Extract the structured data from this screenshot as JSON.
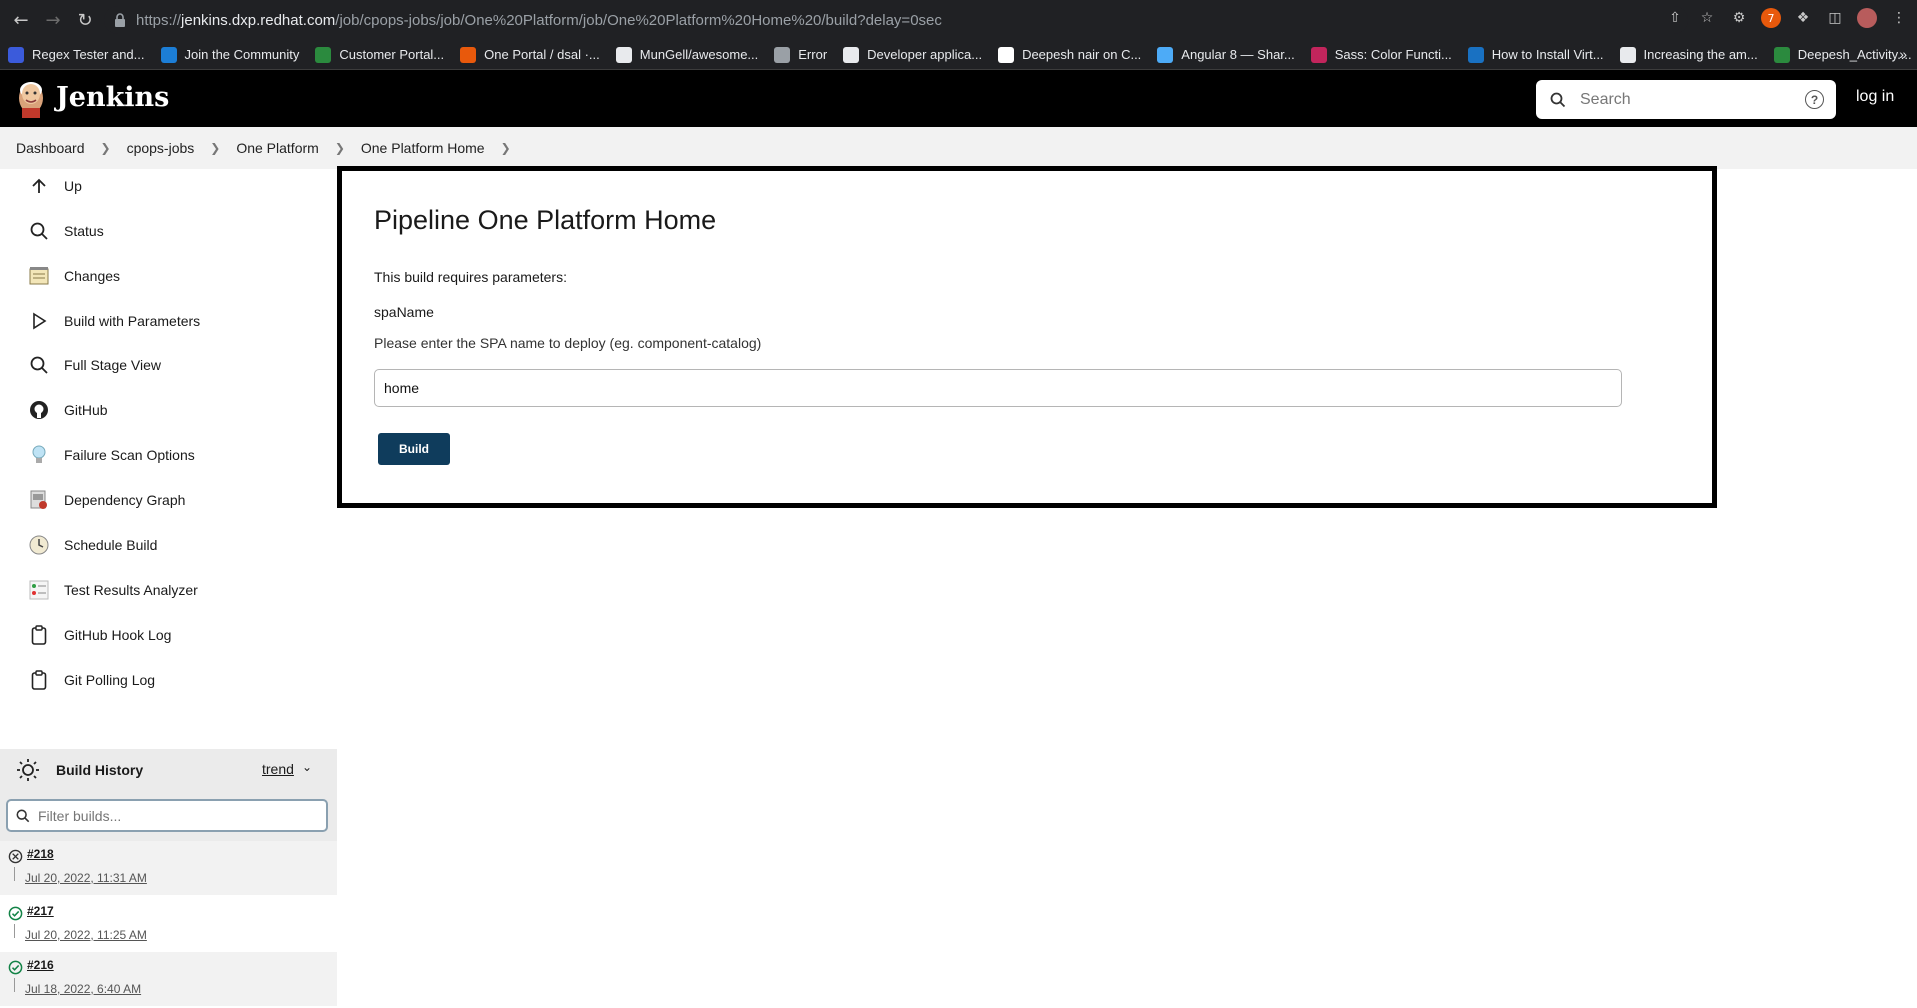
{
  "browser": {
    "url_prefix": "https://",
    "url_host": "jenkins.dxp.redhat.com",
    "url_path": "/job/cpops-jobs/job/One%20Platform/job/One%20Platform%20Home%20/build?delay=0sec",
    "bookmarks": [
      {
        "label": "Regex Tester and...",
        "color": "#3b5bdb"
      },
      {
        "label": "Join the Community",
        "color": "#1c7ed6"
      },
      {
        "label": "Customer Portal...",
        "color": "#2b8a3e"
      },
      {
        "label": "One Portal / dsal ·...",
        "color": "#e8590c"
      },
      {
        "label": "MunGell/awesome...",
        "color": "#e8eaed"
      },
      {
        "label": "Error",
        "color": "#9aa0a6"
      },
      {
        "label": "Developer applica...",
        "color": "#e8eaed"
      },
      {
        "label": "Deepesh nair on C...",
        "color": "#ffffff"
      },
      {
        "label": "Angular 8 — Shar...",
        "color": "#4dabf7"
      },
      {
        "label": "Sass: Color Functi...",
        "color": "#c2255c"
      },
      {
        "label": "How to Install Virt...",
        "color": "#1971c2"
      },
      {
        "label": "Increasing the am...",
        "color": "#e8eaed"
      },
      {
        "label": "Deepesh_Activity....",
        "color": "#2b8a3e"
      }
    ],
    "more": "»"
  },
  "header": {
    "title": "Jenkins",
    "search_placeholder": "Search",
    "help": "?",
    "login": "log in"
  },
  "breadcrumbs": [
    "Dashboard",
    "cpops-jobs",
    "One Platform",
    "One Platform Home"
  ],
  "sidebar": {
    "tasks": [
      {
        "label": "Up",
        "icon": "arrow-up-icon"
      },
      {
        "label": "Status",
        "icon": "search-icon"
      },
      {
        "label": "Changes",
        "icon": "notepad-icon"
      },
      {
        "label": "Build with Parameters",
        "icon": "play-icon"
      },
      {
        "label": "Full Stage View",
        "icon": "search-icon"
      },
      {
        "label": "GitHub",
        "icon": "github-icon"
      },
      {
        "label": "Failure Scan Options",
        "icon": "lightbulb-icon"
      },
      {
        "label": "Dependency Graph",
        "icon": "graph-icon"
      },
      {
        "label": "Schedule Build",
        "icon": "clock-icon"
      },
      {
        "label": "Test Results Analyzer",
        "icon": "analyzer-icon"
      },
      {
        "label": "GitHub Hook Log",
        "icon": "clipboard-icon"
      },
      {
        "label": "Git Polling Log",
        "icon": "clipboard-icon"
      }
    ]
  },
  "build_history": {
    "title": "Build History",
    "trend": "trend",
    "filter_placeholder": "Filter builds...",
    "builds": [
      {
        "number": "#218",
        "date": "Jul 20, 2022, 11:31 AM",
        "status": "aborted"
      },
      {
        "number": "#217",
        "date": "Jul 20, 2022, 11:25 AM",
        "status": "success"
      },
      {
        "number": "#216",
        "date": "Jul 18, 2022, 6:40 AM",
        "status": "success"
      }
    ]
  },
  "main": {
    "title": "Pipeline One Platform Home",
    "requires_text": "This build requires parameters:",
    "param_name": "spaName",
    "param_description": "Please enter the SPA name to deploy (eg. component-catalog)",
    "param_value": "home",
    "build_label": "Build"
  },
  "colors": {
    "header_bg": "#000000",
    "build_button": "#0f3c5c",
    "success": "#138347",
    "aborted": "#333333"
  }
}
